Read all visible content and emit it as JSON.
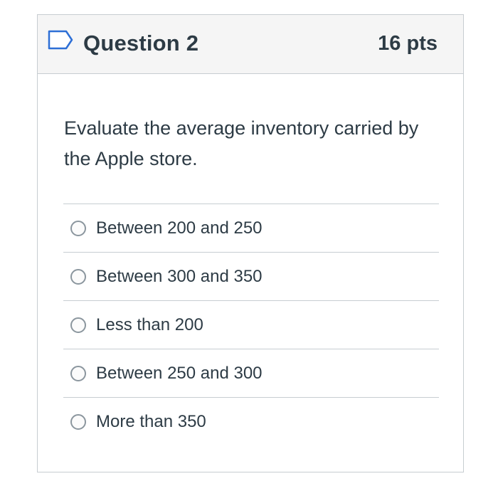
{
  "question": {
    "title": "Question 2",
    "points": "16 pts",
    "text": "Evaluate the average inventory carried by the Apple store.",
    "answers": [
      {
        "label": "Between 200 and 250"
      },
      {
        "label": "Between 300 and 350"
      },
      {
        "label": "Less than 200"
      },
      {
        "label": "Between 250 and 300"
      },
      {
        "label": "More than 350"
      }
    ]
  },
  "colors": {
    "text": "#2d3b45",
    "header_bg": "#f5f5f5",
    "border": "#c7cdd1",
    "flag_icon": "#2d6fd6"
  },
  "icons": {
    "flag": "flag-icon",
    "radio": "radio-icon"
  }
}
